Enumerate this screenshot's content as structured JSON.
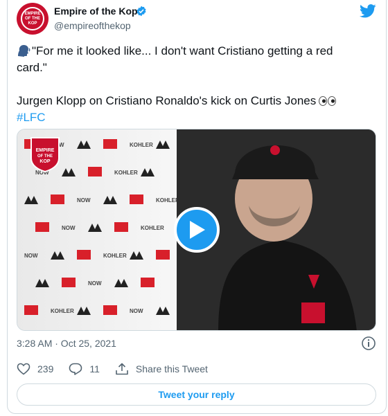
{
  "author": {
    "display_name": "Empire of the Kop",
    "handle": "@empireofthekop",
    "avatar_text": [
      "EMPIRE",
      "OF THE",
      "KOP"
    ],
    "verified": true
  },
  "tweet": {
    "line1": "\"For me it looked like... I don't want Cristiano getting a red",
    "line2": "card.\"",
    "line3": "Jurgen Klopp on Cristiano Ronaldo's kick on Curtis Jones",
    "hashtag": "#LFC"
  },
  "media": {
    "type": "video",
    "badge_text": [
      "EMPIRE",
      "OF THE",
      "KOP"
    ],
    "sponsor_words": [
      "NOW",
      "KOHLER"
    ]
  },
  "meta": {
    "timestamp": "3:28 AM · Oct 25, 2021"
  },
  "actions": {
    "likes": "239",
    "replies": "11",
    "share_label": "Share this Tweet"
  },
  "reply_button_label": "Tweet your reply",
  "colors": {
    "accent": "#1d9bf0",
    "brand_red": "#c8102e",
    "muted": "#536471"
  },
  "icons": [
    "verified-badge-icon",
    "twitter-bird-icon",
    "speaking-head-icon",
    "eyes-icon",
    "play-icon",
    "info-icon",
    "heart-icon",
    "reply-icon",
    "share-icon"
  ]
}
